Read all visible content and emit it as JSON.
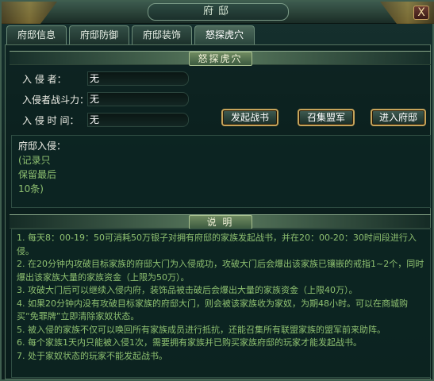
{
  "window": {
    "title": "府邸",
    "close_label": "X"
  },
  "tabs": [
    {
      "label": "府邸信息",
      "active": false
    },
    {
      "label": "府邸防御",
      "active": false
    },
    {
      "label": "府邸装饰",
      "active": false
    },
    {
      "label": "怒探虎穴",
      "active": true
    }
  ],
  "invade_section": {
    "title": "怒探虎穴",
    "fields": [
      {
        "label": "入  侵  者：",
        "value": "无"
      },
      {
        "label": "入侵者战斗力：",
        "value": "无"
      },
      {
        "label": "入  侵  时  间：",
        "value": "无"
      }
    ],
    "buttons": {
      "declare": "发起战书",
      "summon": "召集盟军",
      "enter": "进入府邸"
    }
  },
  "log": {
    "label": "府邸入侵：",
    "note": "(记录只保留最后10条)"
  },
  "rules_section": {
    "title": "说  明",
    "items": [
      "1. 每天8：00-19：50可消耗50万银子对拥有府邸的家族发起战书，并在20：00-20：30时间段进行入侵。",
      "2. 在20分钟内攻破目标家族的府邸大门为入侵成功，攻破大门后会爆出该家族已镶嵌的戒指1~2个，同时爆出该家族大量的家族资金（上限为50万）。",
      "3. 攻破大门后可以继续入侵内府，装饰品被击破后会爆出大量的家族资金（上限40万）。",
      "4. 如果20分钟内没有攻破目标家族的府邸大门，则会被该家族收为家奴，为期48小时。可以在商城购买“免罪牌”立即清除家奴状态。",
      "5. 被入侵的家族不仅可以唤回所有家族成员进行抵抗，还能召集所有联盟家族的盟军前来助阵。",
      "6. 每个家族1天内只能被入侵1次，需要拥有家族并已购买家族府邸的玩家才能发起战书。",
      "7. 处于家奴状态的玩家不能发起战书。"
    ]
  },
  "colors": {
    "rule_text": "#8ec070",
    "button_border": "#c6a45a",
    "panel_bg": "#0f2523"
  }
}
